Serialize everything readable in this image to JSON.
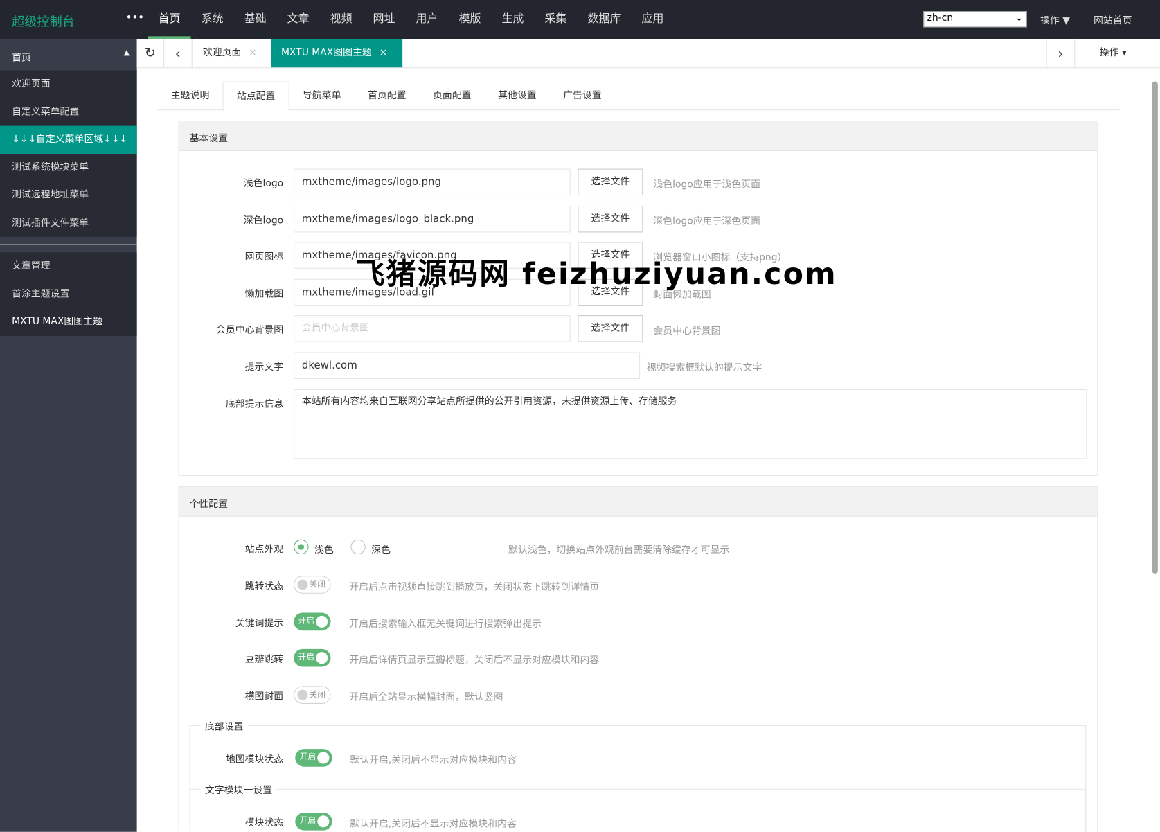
{
  "topbar": {
    "logo": "超级控制台",
    "more": "•••",
    "nav": [
      "首页",
      "系统",
      "基础",
      "文章",
      "视频",
      "网址",
      "用户",
      "模版",
      "生成",
      "采集",
      "数据库",
      "应用"
    ],
    "lang": "zh-cn",
    "action": "操作 ▼",
    "site_home": "网站首页"
  },
  "sidebar": {
    "head": "首页",
    "group1": [
      "欢迎页面",
      "自定义菜单配置",
      "↓↓↓自定义菜单区域↓↓↓",
      "测试系统模块菜单",
      "测试远程地址菜单",
      "测试插件文件菜单"
    ],
    "group2": [
      "文章管理",
      "首涂主题设置",
      "MXTU MAX图图主题"
    ]
  },
  "tabs": {
    "refresh": "↻",
    "prev": "‹",
    "next": "›",
    "items": [
      "欢迎页面",
      "MXTU MAX图图主题"
    ],
    "close": "×",
    "action": "操作 ▾"
  },
  "subtabs": [
    "主题说明",
    "站点配置",
    "导航菜单",
    "首页配置",
    "页面配置",
    "其他设置",
    "广告设置"
  ],
  "basic": {
    "title": "基本设置",
    "choose": "选择文件",
    "rows": [
      {
        "label": "浅色logo",
        "value": "mxtheme/images/logo.png",
        "tip": "浅色logo应用于浅色页面"
      },
      {
        "label": "深色logo",
        "value": "mxtheme/images/logo_black.png",
        "tip": "深色logo应用于深色页面"
      },
      {
        "label": "网页图标",
        "value": "mxtheme/images/favicon.png",
        "tip": "浏览器窗口小图标（支持png）"
      },
      {
        "label": "懒加载图",
        "value": "mxtheme/images/load.gif",
        "tip": "封面懒加载图"
      },
      {
        "label": "会员中心背景图",
        "placeholder": "会员中心背景图",
        "tip": "会员中心背景图"
      }
    ],
    "hint": {
      "label": "提示文字",
      "value": "dkewl.com",
      "tip": "视频搜索框默认的提示文字"
    },
    "footer": {
      "label": "底部提示信息",
      "value": "本站所有内容均来自互联网分享站点所提供的公开引用资源，未提供资源上传、存储服务"
    }
  },
  "personal": {
    "title": "个性配置",
    "appearance": {
      "label": "站点外观",
      "opt1": "浅色",
      "opt2": "深色",
      "tip": "默认浅色，切换站点外观前台需要清除缓存才可显示"
    },
    "switches": [
      {
        "label": "跳转状态",
        "state": "关闭",
        "on": false,
        "tip": "开启后点击视频直接跳到播放页，关闭状态下跳转到详情页"
      },
      {
        "label": "关键词提示",
        "state": "开启",
        "on": true,
        "tip": "开启后搜索输入框无关键词进行搜索弹出提示"
      },
      {
        "label": "豆瓣跳转",
        "state": "开启",
        "on": true,
        "tip": "开启后详情页显示豆瓣标题，关闭后不显示对应模块和内容"
      },
      {
        "label": "横图封面",
        "state": "关闭",
        "on": false,
        "tip": "开启后全站显示横幅封面，默认竖图"
      }
    ],
    "footer_set": {
      "legend": "底部设置",
      "label": "地图模块状态",
      "state": "开启",
      "tip": "默认开启,关闭后不显示对应模块和内容"
    },
    "text_set": {
      "legend": "文字模块一设置",
      "label": "模块状态",
      "state": "开启",
      "tip": "默认开启,关闭后不显示对应模块和内容"
    }
  },
  "watermark": "飞猪源码网 feizhuziyuan.com",
  "colors": {
    "accent": "#009688",
    "green": "#5fb878",
    "dark": "#23262e"
  }
}
